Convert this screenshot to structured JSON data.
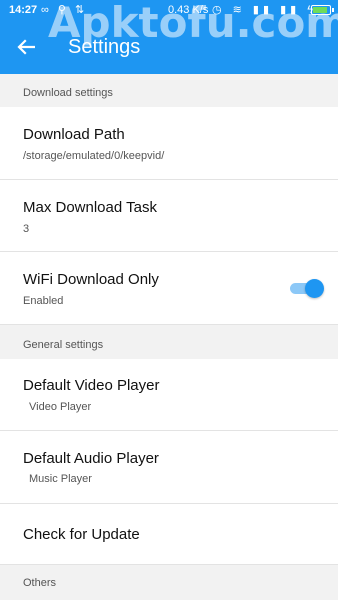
{
  "status_bar": {
    "time": "14:27",
    "left_icons": "∞ ⚲ ⇅",
    "speed": "0.43 K/s",
    "right_icons": "◷ ≋ ▮▮ ▮▮ ϟ"
  },
  "watermark": "Apktofu.com",
  "appbar": {
    "back_icon": "arrow-back-icon",
    "title": "Settings"
  },
  "colors": {
    "primary": "#1e96f2",
    "toggle_track": "#8cc8f7",
    "background": "#f2f2f2"
  },
  "sections": {
    "download_header": "Download settings",
    "general_header": "General settings",
    "others_header": "Others"
  },
  "items": {
    "download_path": {
      "title": "Download Path",
      "value": "/storage/emulated/0/keepvid/"
    },
    "max_task": {
      "title": "Max Download Task",
      "value": "3"
    },
    "wifi_only": {
      "title": "WiFi Download Only",
      "value": "Enabled",
      "toggle_on": true
    },
    "video_player": {
      "title": "Default Video Player",
      "value": "Video Player"
    },
    "audio_player": {
      "title": "Default Audio Player",
      "value": "Music Player"
    },
    "update": {
      "title": "Check for Update"
    }
  }
}
